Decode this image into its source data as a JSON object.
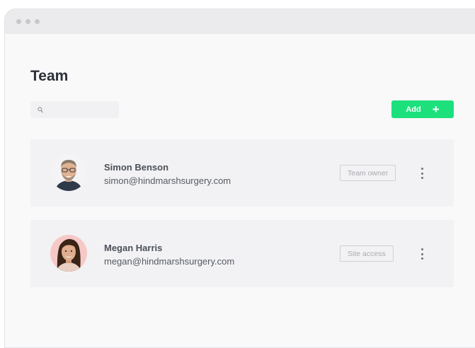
{
  "page": {
    "title": "Team"
  },
  "search": {
    "placeholder": ""
  },
  "toolbar": {
    "add_label": "Add",
    "add_icon": "plus-icon"
  },
  "members": [
    {
      "name": "Simon Benson",
      "email": "simon@hindmarshsurgery.com",
      "role": "Team owner",
      "avatar": "man-with-glasses-avatar"
    },
    {
      "name": "Megan Harris",
      "email": "megan@hindmarshsurgery.com",
      "role": "Site access",
      "avatar": "woman-avatar"
    }
  ],
  "colors": {
    "accent": "#1ce07c",
    "background": "#f9f9f9",
    "card": "#f2f2f4",
    "titlebar": "#ebebed"
  }
}
